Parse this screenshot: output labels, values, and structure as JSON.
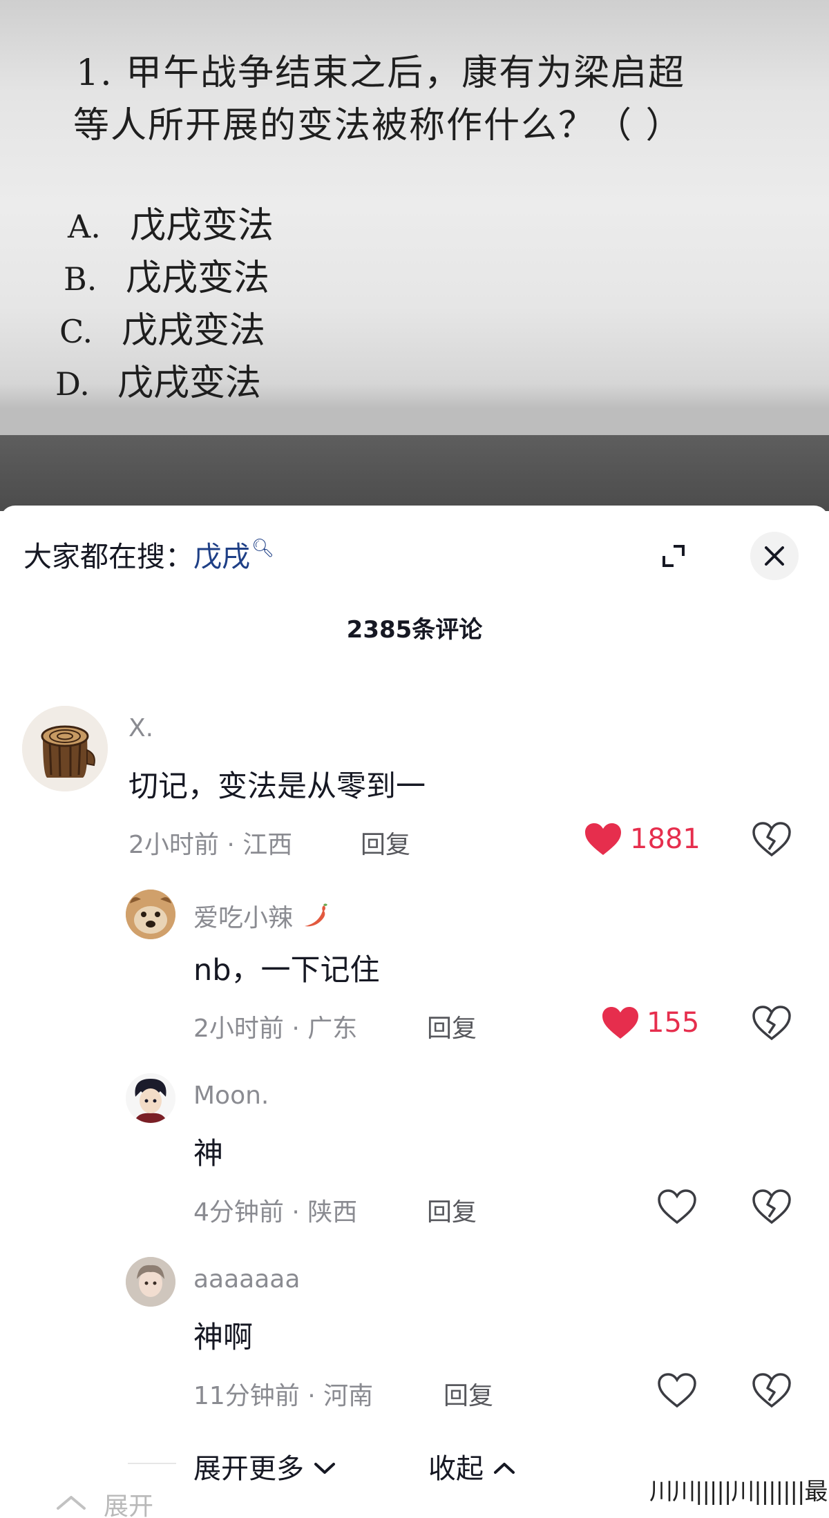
{
  "question": {
    "line1": "1.  甲午战争结束之后，康有为梁启超",
    "line2": "等人所开展的变法被称作什么？（    ）",
    "options": [
      {
        "letter": "A.",
        "text": "戊戌变法"
      },
      {
        "letter": "B.",
        "text": "戊戌变法"
      },
      {
        "letter": "C.",
        "text": "戊戌变法"
      },
      {
        "letter": "D.",
        "text": "戊戌变法"
      }
    ]
  },
  "sheet": {
    "search_prefix": "大家都在搜：",
    "search_keyword": "戊戌",
    "comment_count": "2385条评论"
  },
  "comments": [
    {
      "user": "X.",
      "text": "切记，变法是从零到一",
      "time": "2小时前 · 江西",
      "reply": "回复",
      "likes": "1881",
      "liked": true
    },
    {
      "user": "爱吃小辣",
      "text": "nb，一下记住",
      "time": "2小时前 · 广东",
      "reply": "回复",
      "likes": "155",
      "liked": true
    },
    {
      "user": "Moon.",
      "text": "神",
      "time": "4分钟前 · 陕西",
      "reply": "回复",
      "likes": "",
      "liked": false
    },
    {
      "user": "aaaaaaa",
      "text": "神啊",
      "time": "11分钟前 · 河南",
      "reply": "回复",
      "likes": "",
      "liked": false
    }
  ],
  "footer": {
    "expand_more": "展开更多",
    "collapse": "收起",
    "bottom_expand": "展开",
    "watermark": "川川|||||川|||||||最"
  },
  "colors": {
    "like_red": "#e62e4d",
    "keyword_blue": "#1e3f86",
    "meta_gray": "#8a8b91"
  }
}
